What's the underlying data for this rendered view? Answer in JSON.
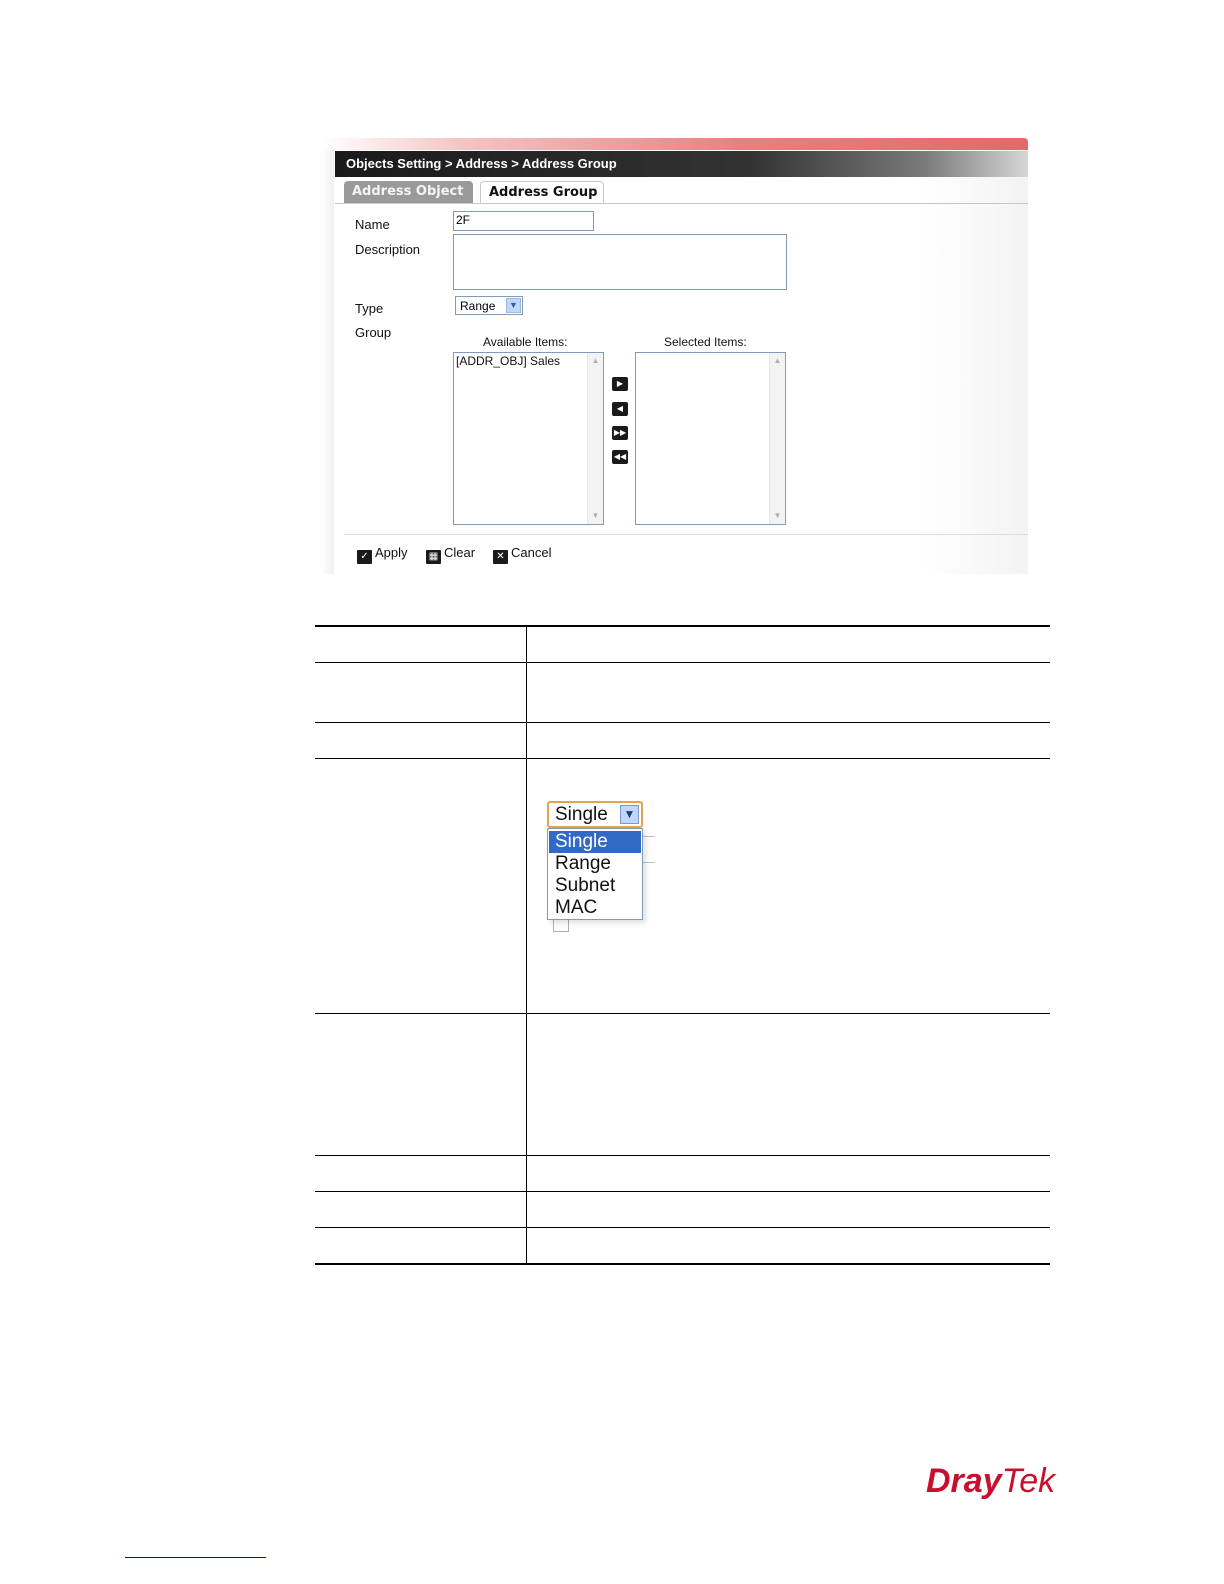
{
  "window": {
    "breadcrumb": "Objects Setting > Address > Address Group"
  },
  "tabs": [
    {
      "label": "Address Object",
      "active": false
    },
    {
      "label": "Address Group",
      "active": true
    }
  ],
  "form": {
    "name_label": "Name",
    "name_value": "2F",
    "description_label": "Description",
    "description_value": "",
    "type_label": "Type",
    "type_value": "Range",
    "group_label": "Group",
    "available_caption": "Available Items:",
    "available_items": [
      "[ADDR_OBJ] Sales"
    ],
    "selected_caption": "Selected Items:",
    "selected_items": []
  },
  "footer_buttons": {
    "apply": "Apply",
    "clear": "Clear",
    "cancel": "Cancel"
  },
  "type_dropdown": {
    "current": "Single",
    "options": [
      "Single",
      "Range",
      "Subnet",
      "MAC"
    ],
    "highlighted": "Single"
  },
  "logo": {
    "part1": "Dray",
    "part2": "Tek"
  },
  "colors": {
    "accent_red": "#c8102e",
    "selection_blue": "#3169c6",
    "title_bar": "#1a1a1a"
  }
}
